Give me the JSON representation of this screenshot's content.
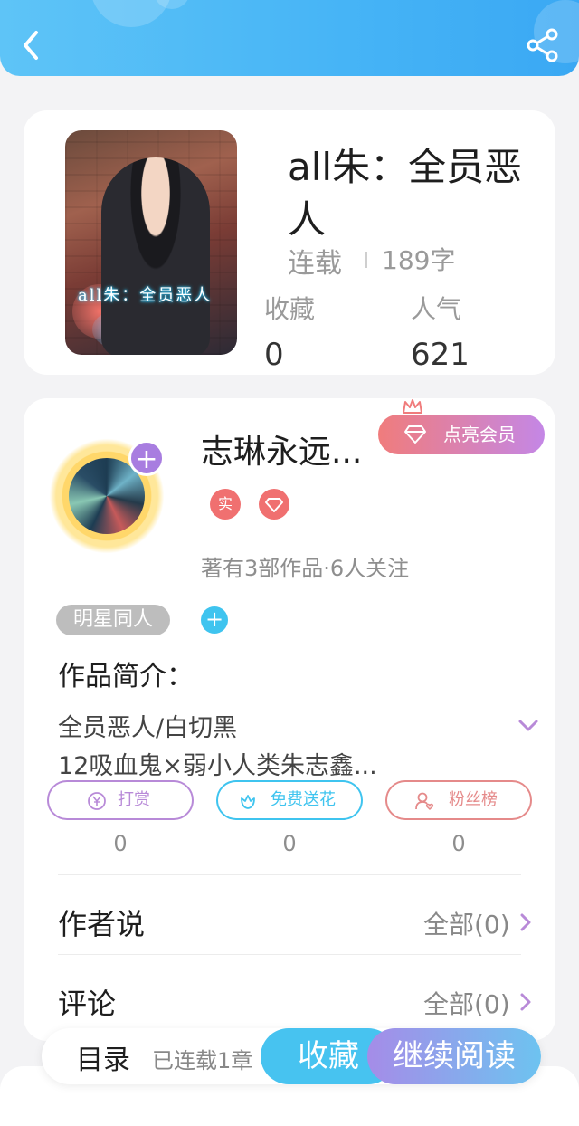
{
  "colors": {
    "header": "#46b4f6",
    "accent_purple": "#a87de0",
    "accent_blue": "#47c3f0",
    "accent_red": "#f07070"
  },
  "book": {
    "title": "all朱：全员恶人",
    "cover_text": "all朱：全员恶人",
    "status": "连载",
    "words": "189字",
    "stats": [
      {
        "label": "收藏",
        "value": "0"
      },
      {
        "label": "人气",
        "value": "621"
      }
    ]
  },
  "author": {
    "name": "志琳永远...",
    "vip_label": "点亮会员",
    "badges": [
      "实",
      "diamond-icon"
    ],
    "meta": "著有3部作品·6人关注"
  },
  "tag": {
    "label": "明星同人",
    "add": "+"
  },
  "intro": {
    "heading": "作品简介：",
    "lines": [
      "全员恶人/白切黑",
      "12吸血鬼×弱小人类朱志鑫..."
    ]
  },
  "actions": [
    {
      "label": "打赏",
      "count": "0",
      "icon": "yen-icon",
      "color": "#b88ad8"
    },
    {
      "label": "免费送花",
      "count": "0",
      "icon": "flower-icon",
      "color": "#3fc4ef"
    },
    {
      "label": "粉丝榜",
      "count": "0",
      "icon": "fan-icon",
      "color": "#e58a8a"
    }
  ],
  "rows": [
    {
      "title": "作者说",
      "link": "全部(0)"
    },
    {
      "title": "评论",
      "link": "全部(0)"
    }
  ],
  "bottom": {
    "toc": "目录",
    "toc_sub": "已连载1章",
    "favorite": "收藏",
    "continue": "继续阅读"
  }
}
